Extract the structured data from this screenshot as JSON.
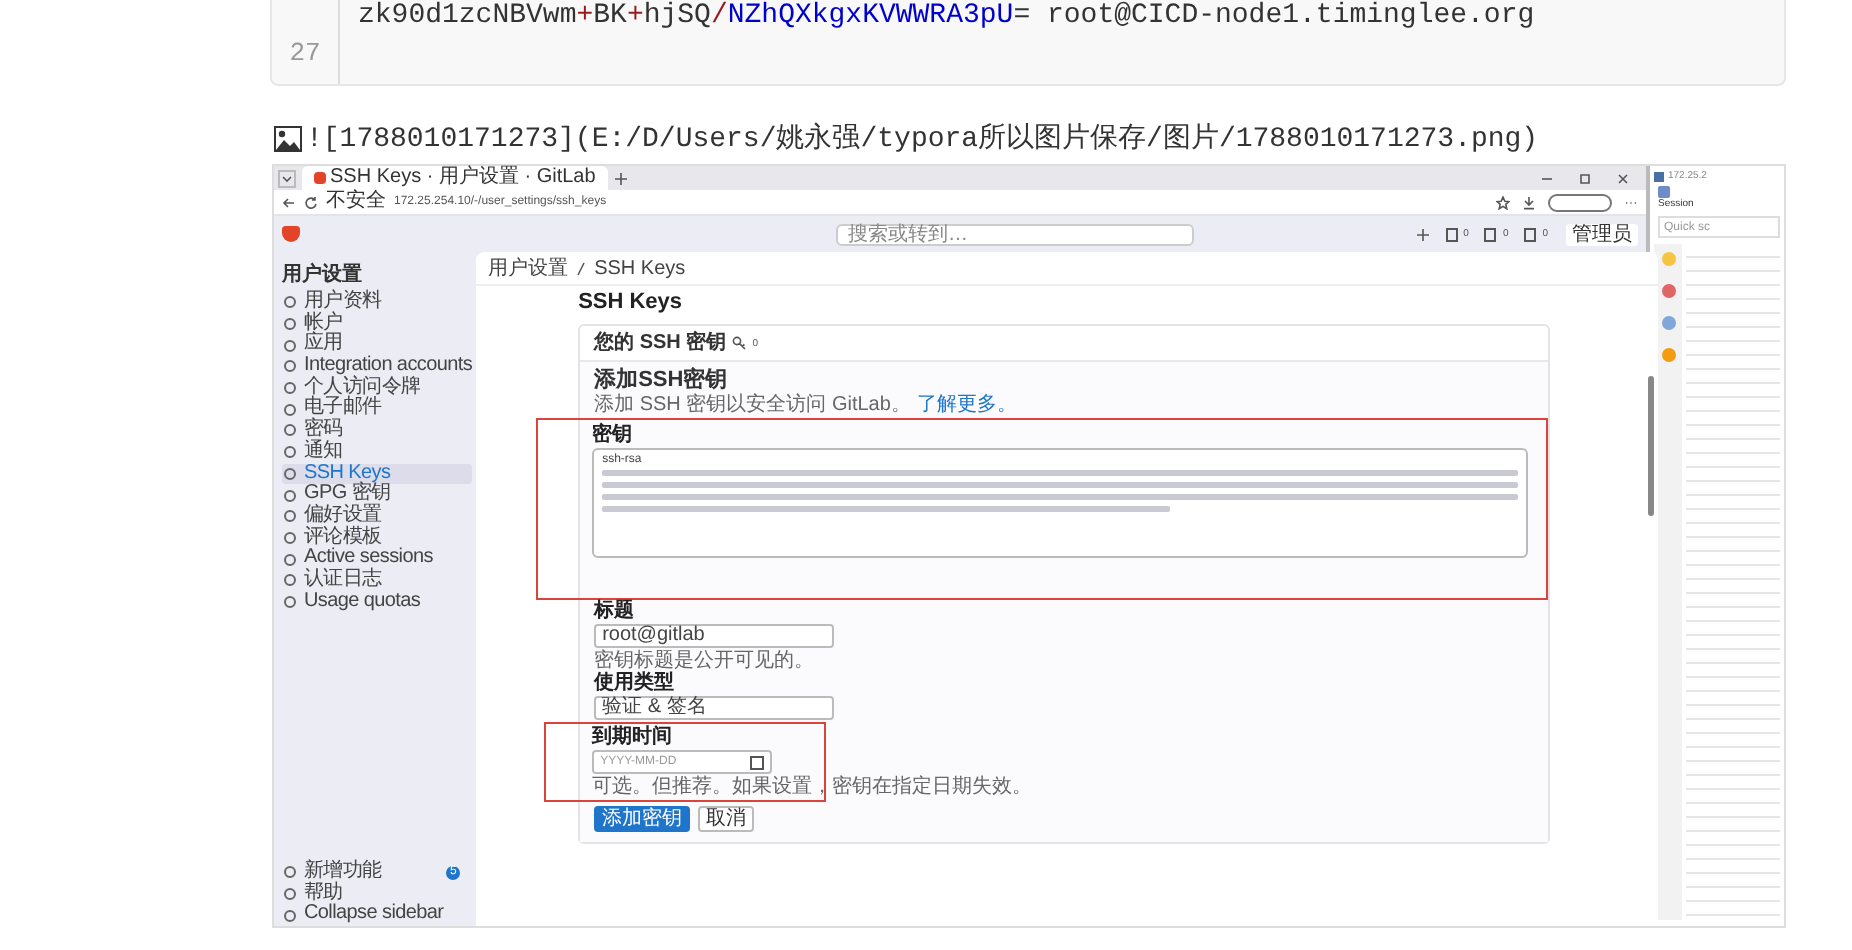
{
  "code_block": {
    "line": {
      "tokens": [
        {
          "text": "zk90d1zcNBVwm",
          "kind": "plain"
        },
        {
          "text": "+",
          "kind": "operator"
        },
        {
          "text": "BK",
          "kind": "plain"
        },
        {
          "text": "+",
          "kind": "operator"
        },
        {
          "text": "hjSQ",
          "kind": "plain"
        },
        {
          "text": "/",
          "kind": "operator"
        },
        {
          "text": "NZhQXkgxKVWWRA3pU",
          "kind": "variable"
        },
        {
          "text": "= root@CICD-node1.timinglee.org",
          "kind": "plain"
        }
      ]
    },
    "line_number": "27"
  },
  "image_link": "![1788010171273](E:/D/Users/姚永强/typora所以图片保存/图片/1788010171273.png)",
  "screenshot": {
    "browser": {
      "tab_title": "SSH Keys · 用户设置 · GitLab",
      "address_warning": "不安全",
      "address": "172.25.254.10/-/user_settings/ssh_keys"
    },
    "topbar": {
      "search_placeholder": "搜索或转到…",
      "counters": [
        "0",
        "0",
        "0"
      ],
      "admin_button": "管理员"
    },
    "sidebar": {
      "title": "用户设置",
      "items": [
        {
          "label": "用户资料",
          "selected": false
        },
        {
          "label": "帐户",
          "selected": false
        },
        {
          "label": "应用",
          "selected": false
        },
        {
          "label": "Integration accounts",
          "selected": false
        },
        {
          "label": "个人访问令牌",
          "selected": false
        },
        {
          "label": "电子邮件",
          "selected": false
        },
        {
          "label": "密码",
          "selected": false
        },
        {
          "label": "通知",
          "selected": false
        },
        {
          "label": "SSH Keys",
          "selected": true
        },
        {
          "label": "GPG 密钥",
          "selected": false
        },
        {
          "label": "偏好设置",
          "selected": false
        },
        {
          "label": "评论模板",
          "selected": false
        },
        {
          "label": "Active sessions",
          "selected": false
        },
        {
          "label": "认证日志",
          "selected": false
        },
        {
          "label": "Usage quotas",
          "selected": false
        }
      ],
      "bottom": [
        {
          "label": "新增功能",
          "badge": "5"
        },
        {
          "label": "帮助"
        },
        {
          "label": "Collapse sidebar"
        }
      ]
    },
    "breadcrumb": [
      "用户设置",
      "SSH Keys"
    ],
    "heading": "SSH Keys",
    "card": {
      "title": "您的 SSH 密钥",
      "count": "0"
    },
    "form": {
      "title": "添加SSH密钥",
      "intro": "添加 SSH 密钥以安全访问 GitLab。",
      "intro_link": "了解更多。",
      "key_label": "密钥",
      "key_first_line": "ssh-rsa",
      "title_label": "标题",
      "title_value": "root@gitlab",
      "title_hint": "密钥标题是公开可见的。",
      "usage_label": "使用类型",
      "usage_value": "验证 & 签名",
      "expiry_label": "到期时间",
      "expiry_placeholder": "YYYY-MM-DD",
      "expiry_hint": "可选。但推荐。如果设置，密钥在指定日期失效。",
      "buttons": [
        {
          "label": "添加密钥",
          "kind": "primary"
        },
        {
          "label": "取消",
          "kind": "default"
        }
      ]
    },
    "side_app": {
      "title": "172.25.2",
      "session_label": "Session",
      "search_placeholder": "Quick sc"
    }
  }
}
